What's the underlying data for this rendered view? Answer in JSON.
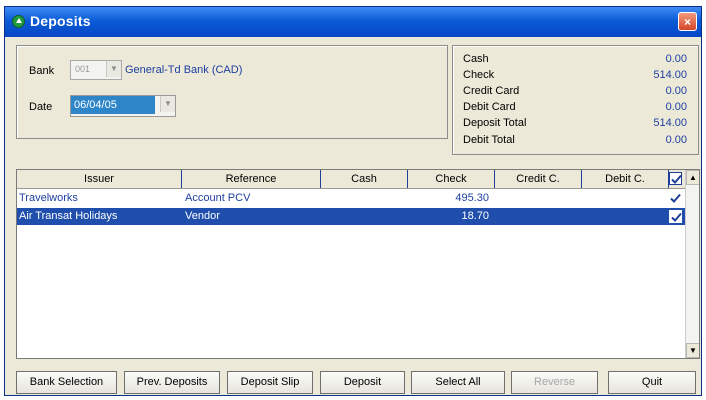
{
  "window": {
    "title": "Deposits",
    "close_label": "×"
  },
  "bank_section": {
    "bank_label": "Bank",
    "bank_code": "001",
    "bank_name": "General-Td Bank  (CAD)",
    "date_label": "Date",
    "date_value": "06/04/05"
  },
  "totals": [
    {
      "label": "Cash",
      "value": "0.00"
    },
    {
      "label": "Check",
      "value": "514.00"
    },
    {
      "label": "Credit Card",
      "value": "0.00"
    },
    {
      "label": "Debit Card",
      "value": "0.00"
    },
    {
      "label": "Deposit Total",
      "value": "514.00"
    },
    {
      "label": "Debit Total",
      "value": "0.00"
    }
  ],
  "grid": {
    "columns": [
      "Issuer",
      "Reference",
      "Cash",
      "Check",
      "Credit C.",
      "Debit C."
    ],
    "rows": [
      {
        "issuer": "Travelworks",
        "reference": "Account PCV",
        "cash": "",
        "check": "495.30",
        "credit": "",
        "debit": "",
        "checked": true,
        "selected": false
      },
      {
        "issuer": "Air Transat Holidays",
        "reference": "Vendor",
        "cash": "",
        "check": "18.70",
        "credit": "",
        "debit": "",
        "checked": true,
        "selected": true
      }
    ]
  },
  "buttons": {
    "bank_selection": "Bank Selection",
    "prev_deposits": "Prev. Deposits",
    "deposit_slip": "Deposit Slip",
    "deposit": "Deposit",
    "select_all": "Select All",
    "reverse": "Reverse",
    "quit": "Quit"
  },
  "colors": {
    "title_bar": "#0b5bd7",
    "selected_row": "#1f4eac",
    "value_text": "#1e3fa0"
  }
}
